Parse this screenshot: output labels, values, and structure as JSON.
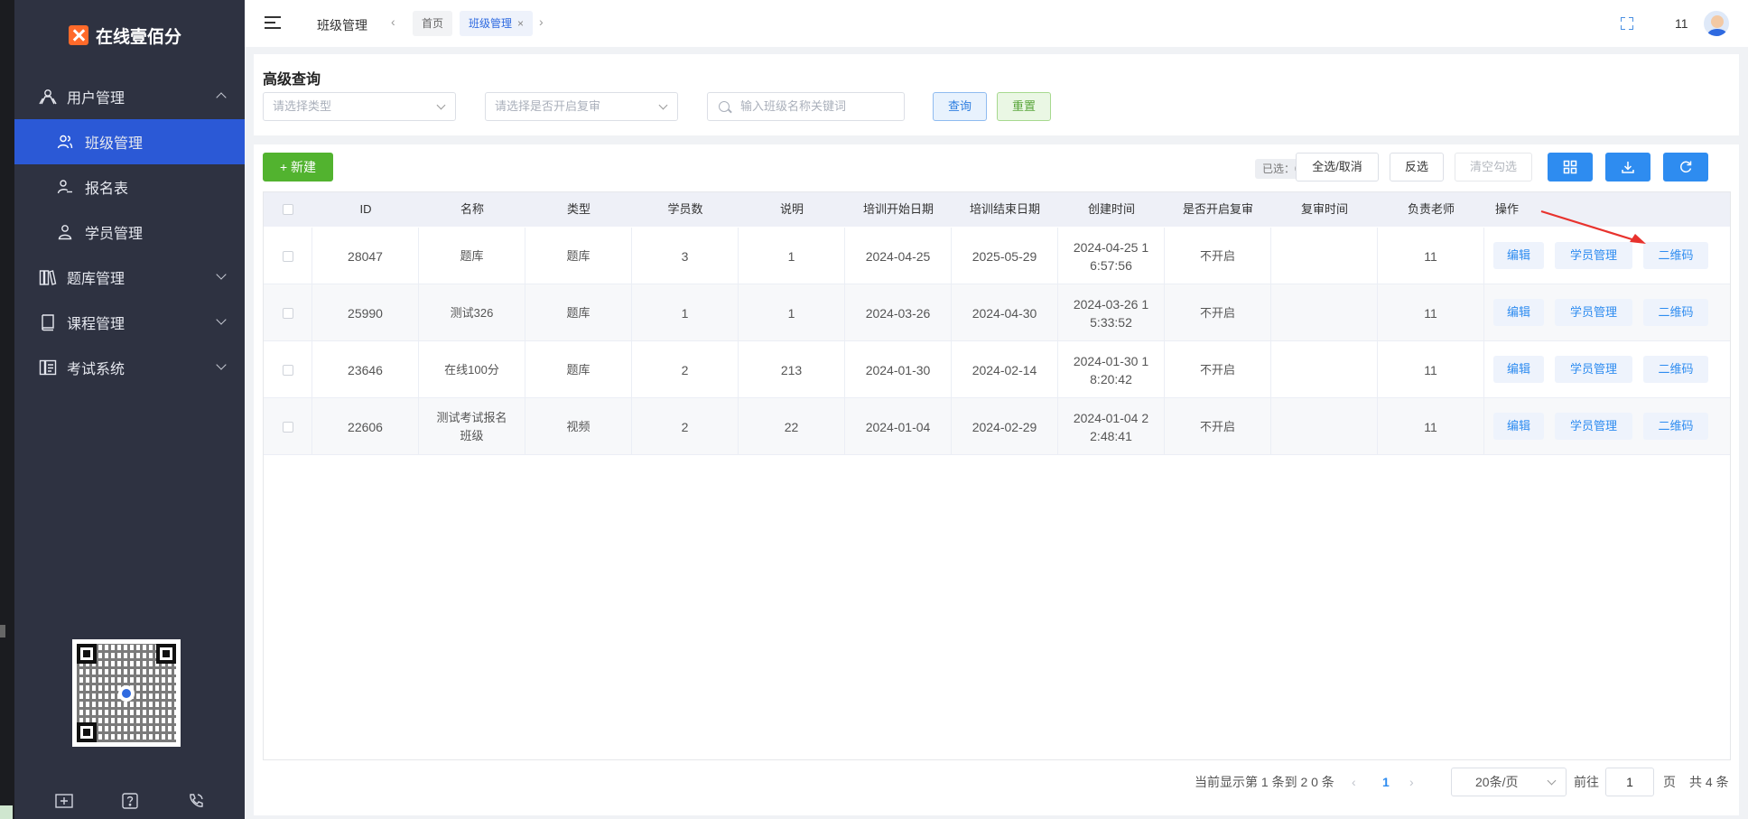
{
  "app": {
    "logo_text": "在线壹佰分",
    "brand_color": "#ff6a2a"
  },
  "sidebar": {
    "menus": [
      {
        "label": "用户管理",
        "icon": "users-icon",
        "expanded": true
      },
      {
        "label": "题库管理",
        "icon": "book-shelf-icon",
        "expanded": false
      },
      {
        "label": "课程管理",
        "icon": "book-icon",
        "expanded": false
      },
      {
        "label": "考试系统",
        "icon": "exam-icon",
        "expanded": false
      }
    ],
    "sub_items": [
      {
        "label": "班级管理",
        "icon": "class-users-icon",
        "active": true
      },
      {
        "label": "报名表",
        "icon": "signup-icon",
        "active": false
      },
      {
        "label": "学员管理",
        "icon": "student-icon",
        "active": false
      }
    ],
    "active_color": "#2b59d6"
  },
  "topbar": {
    "page_name": "班级管理",
    "tabs": [
      {
        "label": "首页",
        "active": false
      },
      {
        "label": "班级管理",
        "active": true,
        "close": "×"
      }
    ],
    "username": "11"
  },
  "search": {
    "title": "高级查询",
    "type_placeholder": "请选择类型",
    "review_placeholder": "请选择是否开启复审",
    "keyword_placeholder": "输入班级名称关键词",
    "query_label": "查询",
    "reset_label": "重置"
  },
  "toolbar": {
    "new_label": "+ 新建",
    "selected_label": "已选：0",
    "select_all_label": "全选/取消",
    "invert_label": "反选",
    "clear_label": "清空勾选"
  },
  "table": {
    "columns": [
      "ID",
      "名称",
      "类型",
      "学员数",
      "说明",
      "培训开始日期",
      "培训结束日期",
      "创建时间",
      "是否开启复审",
      "复审时间",
      "负责老师",
      "操作"
    ],
    "rows": [
      {
        "id": "28047",
        "name": "题库",
        "type": "题库",
        "students": "3",
        "desc": "1",
        "start": "2024-04-25",
        "end": "2025-05-29",
        "created_l1": "2024-04-25 1",
        "created_l2": "6:57:56",
        "review": "不开启",
        "review_time": "",
        "teacher": "11"
      },
      {
        "id": "25990",
        "name": "测试326",
        "type": "题库",
        "students": "1",
        "desc": "1",
        "start": "2024-03-26",
        "end": "2024-04-30",
        "created_l1": "2024-03-26 1",
        "created_l2": "5:33:52",
        "review": "不开启",
        "review_time": "",
        "teacher": "11"
      },
      {
        "id": "23646",
        "name": "在线100分",
        "type": "题库",
        "students": "2",
        "desc": "213",
        "start": "2024-01-30",
        "end": "2024-02-14",
        "created_l1": "2024-01-30 1",
        "created_l2": "8:20:42",
        "review": "不开启",
        "review_time": "",
        "teacher": "11"
      },
      {
        "id": "22606",
        "name_l1": "测试考试报名",
        "name_l2": "班级",
        "type": "视频",
        "students": "2",
        "desc": "22",
        "start": "2024-01-04",
        "end": "2024-02-29",
        "created_l1": "2024-01-04 2",
        "created_l2": "2:48:41",
        "review": "不开启",
        "review_time": "",
        "teacher": "11"
      }
    ],
    "actions": {
      "edit": "编辑",
      "students": "学员管理",
      "qrcode": "二维码"
    }
  },
  "pagination": {
    "summary": "当前显示第 1 条到 2 0 条",
    "current_page": "1",
    "page_size": "20条/页",
    "goto_label": "前往",
    "goto_value": "1",
    "page_unit": "页",
    "total": "共 4 条"
  }
}
